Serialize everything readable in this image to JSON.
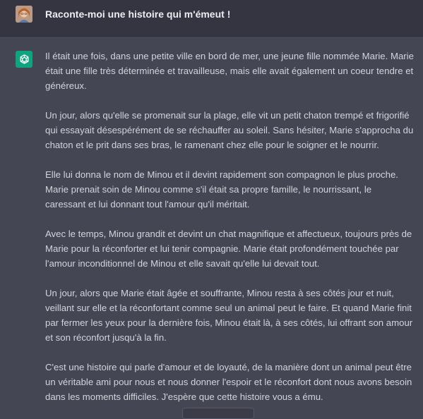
{
  "user": {
    "message": "Raconte-moi une histoire qui m'émeut !"
  },
  "assistant": {
    "paragraphs": [
      "Il était une fois, dans une petite ville en bord de mer, une jeune fille nommée Marie. Marie était une fille très déterminée et travailleuse, mais elle avait également un coeur tendre et généreux.",
      "Un jour, alors qu'elle se promenait sur la plage, elle vit un petit chaton trempé et frigorifié qui essayait désespérément de se réchauffer au soleil. Sans hésiter, Marie s'approcha du chaton et le prit dans ses bras, le ramenant chez elle pour le soigner et le nourrir.",
      "Elle lui donna le nom de Minou et il devint rapidement son compagnon le plus proche. Marie prenait soin de Minou comme s'il était sa propre famille, le nourrissant, le caressant et lui donnant tout l'amour qu'il méritait.",
      "Avec le temps, Minou grandit et devint un chat magnifique et affectueux, toujours près de Marie pour la réconforter et lui tenir compagnie. Marie était profondément touchée par l'amour inconditionnel de Minou et elle savait qu'elle lui devait tout.",
      "Un jour, alors que Marie était âgée et souffrante, Minou resta à ses côtés jour et nuit, veillant sur elle et la réconfortant comme seul un animal peut le faire. Et quand Marie finit par fermer les yeux pour la dernière fois, Minou était là, à ses côtés, lui offrant son amour et son réconfort jusqu'à la fin.",
      "C'est une histoire qui parle d'amour et de loyauté, de la manière dont un animal peut être un véritable ami pour nous et nous donner l'espoir et le réconfort dont nous avons besoin dans les moments difficiles. J'espère que cette histoire vous a ému."
    ]
  },
  "icons": {
    "user_avatar": "user-avatar-photo",
    "assistant_avatar": "openai-logo-icon"
  },
  "colors": {
    "user_bg": "#343541",
    "assistant_bg": "#444654",
    "brand": "#10a37f",
    "text": "#d1d5db"
  }
}
